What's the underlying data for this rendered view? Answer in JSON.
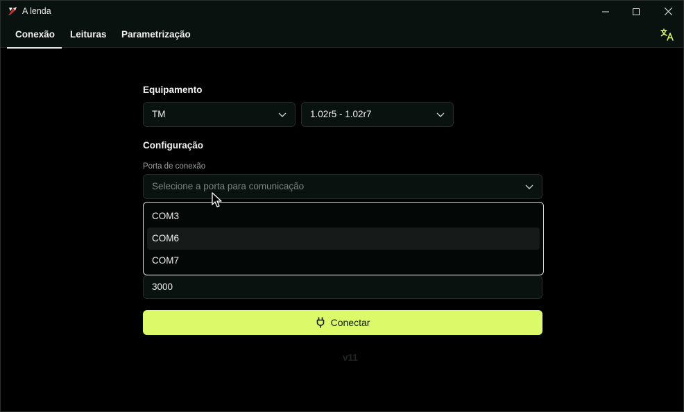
{
  "window": {
    "title": "A lenda"
  },
  "tabs": [
    {
      "label": "Conexão",
      "active": true
    },
    {
      "label": "Leituras",
      "active": false
    },
    {
      "label": "Parametrização",
      "active": false
    }
  ],
  "equipment": {
    "title": "Equipamento",
    "model_value": "TM",
    "version_value": "1.02r5 - 1.02r7"
  },
  "configuration": {
    "title": "Configuração",
    "port_label": "Porta de conexão",
    "port_placeholder": "Selecione a porta para comunicação",
    "port_options": [
      "COM3",
      "COM6",
      "COM7"
    ],
    "hovered_option": "COM6",
    "timeout_value": "3000"
  },
  "connect_label": "Conectar",
  "version_label": "v11",
  "colors": {
    "accent": "#dbf969",
    "background": "#000000",
    "surface": "#0a1210"
  },
  "icons": [
    "app-logo-icon",
    "minimize-icon",
    "maximize-icon",
    "close-icon",
    "translate-icon",
    "chevron-down-icon",
    "plug-icon",
    "mouse-cursor-icon"
  ]
}
